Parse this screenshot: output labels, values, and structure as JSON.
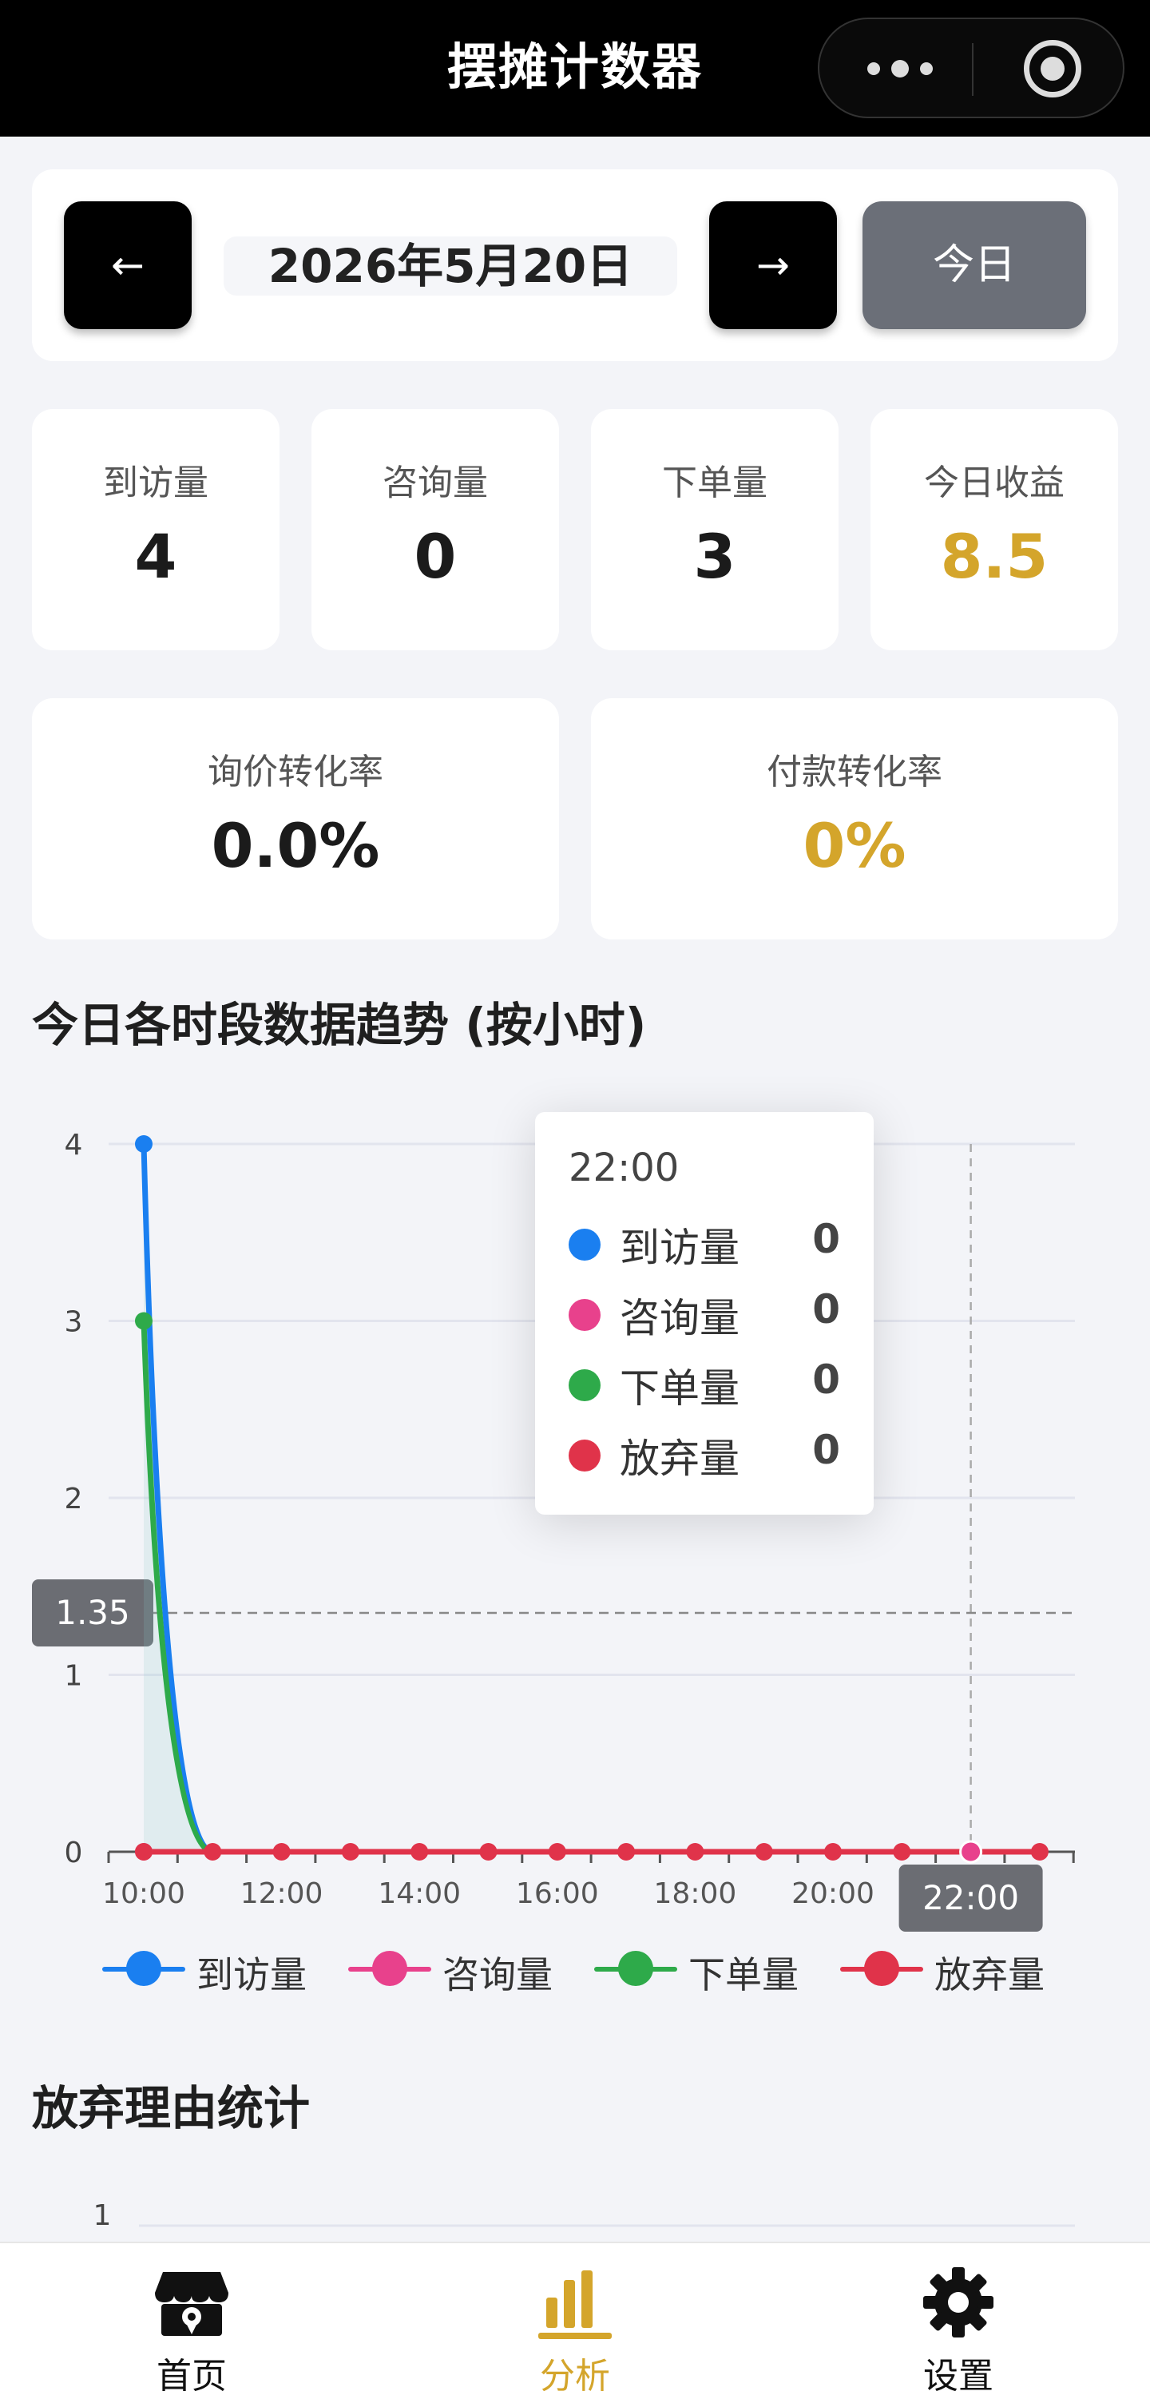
{
  "app": {
    "title": "摆摊计数器",
    "capsule_icons": [
      "more-icon",
      "target-icon"
    ]
  },
  "date_nav": {
    "prev_label": "←",
    "date": "2026年5月20日",
    "next_label": "→",
    "today_label": "今日"
  },
  "stats": [
    {
      "label": "到访量",
      "value": "4"
    },
    {
      "label": "咨询量",
      "value": "0"
    },
    {
      "label": "下单量",
      "value": "3"
    },
    {
      "label": "今日收益",
      "value": "8.5"
    }
  ],
  "rates": [
    {
      "label": "询价转化率",
      "value": "0.0%"
    },
    {
      "label": "付款转化率",
      "value": "0%"
    }
  ],
  "colors": {
    "accent_gold": "#d4a52b",
    "visits": "#1a7ff0",
    "inquiries": "#e8418c",
    "orders": "#2eaa4a",
    "abandon": "#e0334a"
  },
  "trend_section_title": "今日各时段数据趋势 (按小时)",
  "chart_data": {
    "type": "line",
    "title": "",
    "x": [
      "10:00",
      "11:00",
      "12:00",
      "13:00",
      "14:00",
      "15:00",
      "16:00",
      "17:00",
      "18:00",
      "19:00",
      "20:00",
      "21:00",
      "22:00",
      "23:00"
    ],
    "x_tick_labels": [
      "10:00",
      "12:00",
      "14:00",
      "16:00",
      "18:00",
      "20:00",
      "22:00"
    ],
    "ylim": [
      0,
      4
    ],
    "y_tick_labels": [
      "0",
      "1",
      "2",
      "3",
      "4"
    ],
    "grid": true,
    "smooth": true,
    "legend_position": "bottom",
    "series": [
      {
        "name": "到访量",
        "values": [
          4,
          0,
          0,
          0,
          0,
          0,
          0,
          0,
          0,
          0,
          0,
          0,
          0,
          0
        ]
      },
      {
        "name": "咨询量",
        "values": [
          0,
          0,
          0,
          0,
          0,
          0,
          0,
          0,
          0,
          0,
          0,
          0,
          0,
          0
        ]
      },
      {
        "name": "下单量",
        "values": [
          3,
          0,
          0,
          0,
          0,
          0,
          0,
          0,
          0,
          0,
          0,
          0,
          0,
          0
        ]
      },
      {
        "name": "放弃量",
        "values": [
          0,
          0,
          0,
          0,
          0,
          0,
          0,
          0,
          0,
          0,
          0,
          0,
          0,
          0
        ]
      }
    ],
    "crosshair": {
      "x_label": "22:00",
      "y_label": "1.35",
      "y_value": 1.35,
      "x_value": "22:00"
    },
    "tooltip": {
      "time": "22:00",
      "rows": [
        {
          "name": "到访量",
          "value": "0"
        },
        {
          "name": "咨询量",
          "value": "0"
        },
        {
          "name": "下单量",
          "value": "0"
        },
        {
          "name": "放弃量",
          "value": "0"
        }
      ]
    }
  },
  "legend": [
    "到访量",
    "咨询量",
    "下单量",
    "放弃量"
  ],
  "abandon_section_title": "放弃理由统计",
  "abandon_chart": {
    "y_tick_label": "1"
  },
  "tabs": [
    {
      "label": "首页",
      "icon": "shop-icon"
    },
    {
      "label": "分析",
      "icon": "bar-chart-icon"
    },
    {
      "label": "设置",
      "icon": "gear-icon"
    }
  ]
}
